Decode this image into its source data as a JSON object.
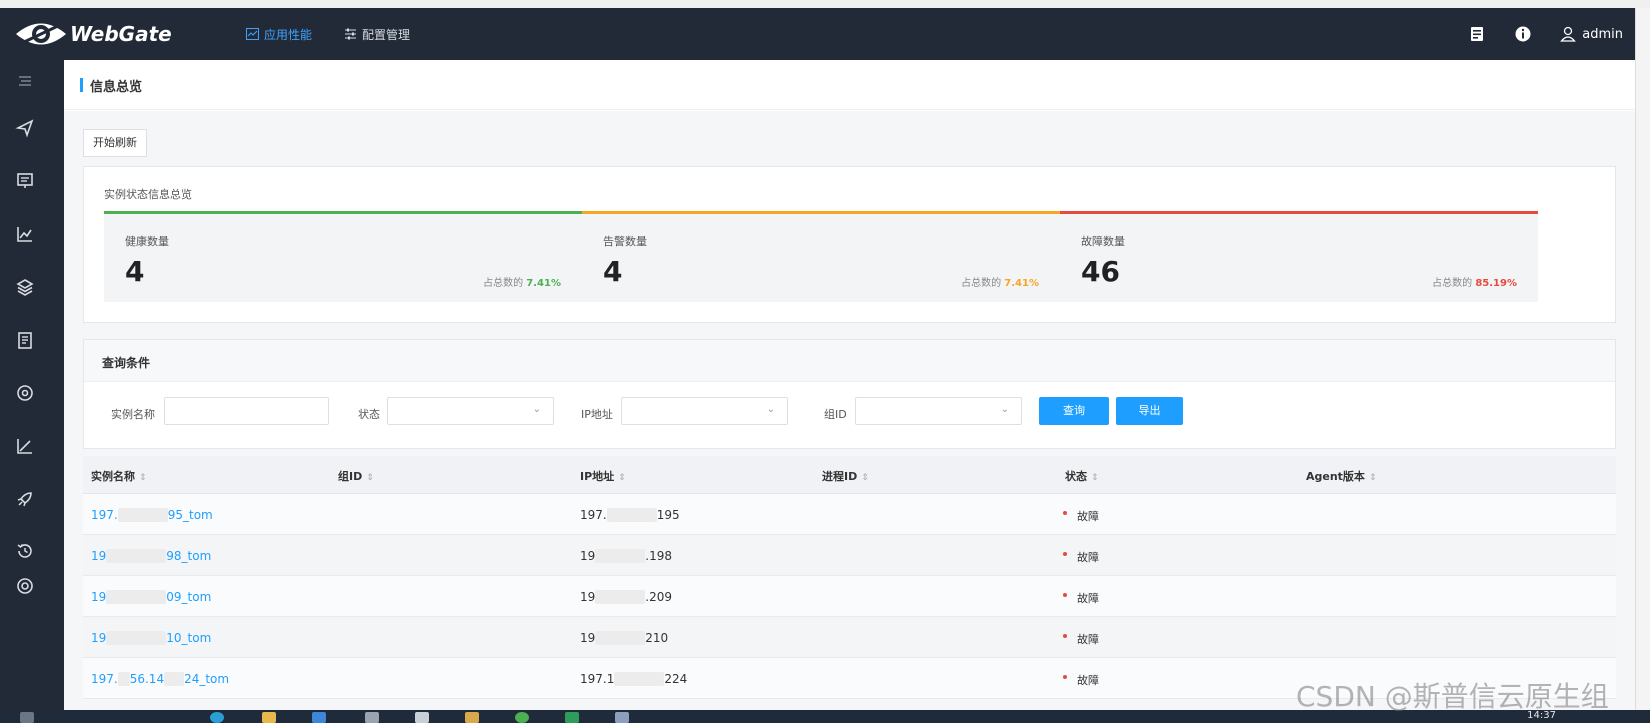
{
  "app": {
    "name": "WebGate"
  },
  "header": {
    "nav": [
      {
        "label": "应用性能",
        "active": true
      },
      {
        "label": "配置管理",
        "active": false
      }
    ],
    "user": "admin"
  },
  "page": {
    "title": "信息总览",
    "refresh_label": "开始刷新"
  },
  "status_summary": {
    "title": "实例状态信息总览",
    "pct_prefix": "占总数的",
    "cards": [
      {
        "label": "健康数量",
        "value": "4",
        "pct": "7.41%",
        "color": "#4caf50"
      },
      {
        "label": "告警数量",
        "value": "4",
        "pct": "7.41%",
        "color": "#f5a623"
      },
      {
        "label": "故障数量",
        "value": "46",
        "pct": "85.19%",
        "color": "#e64b3c"
      }
    ]
  },
  "query": {
    "title": "查询条件",
    "fields": {
      "instance_name": "实例名称",
      "status": "状态",
      "ip": "IP地址",
      "group_id": "组ID"
    },
    "search_label": "查询",
    "export_label": "导出"
  },
  "table": {
    "columns": [
      "实例名称",
      "组ID",
      "IP地址",
      "进程ID",
      "状态",
      "Agent版本"
    ],
    "rows": [
      {
        "name_a": "197.",
        "name_b": "95_tom",
        "group": "",
        "ip_a": "197.",
        "ip_b": "195",
        "pid": "",
        "status": "故障",
        "agent": ""
      },
      {
        "name_a": "19",
        "name_b": "98_tom",
        "group": "",
        "ip_a": "19",
        "ip_b": ".198",
        "pid": "",
        "status": "故障",
        "agent": ""
      },
      {
        "name_a": "19",
        "name_b": "09_tom",
        "group": "",
        "ip_a": "19",
        "ip_b": ".209",
        "pid": "",
        "status": "故障",
        "agent": ""
      },
      {
        "name_a": "19",
        "name_b": "10_tom",
        "group": "",
        "ip_a": "19",
        "ip_b": "210",
        "pid": "",
        "status": "故障",
        "agent": ""
      },
      {
        "name_a": "197.",
        "name_b": "56.14",
        "name_c": "24_tom",
        "group": "",
        "ip_a": "197.1",
        "ip_b": "224",
        "pid": "",
        "status": "故障",
        "agent": ""
      }
    ]
  },
  "taskbar": {
    "time": "14:37"
  },
  "watermark": "CSDN @斯普信云原生组"
}
